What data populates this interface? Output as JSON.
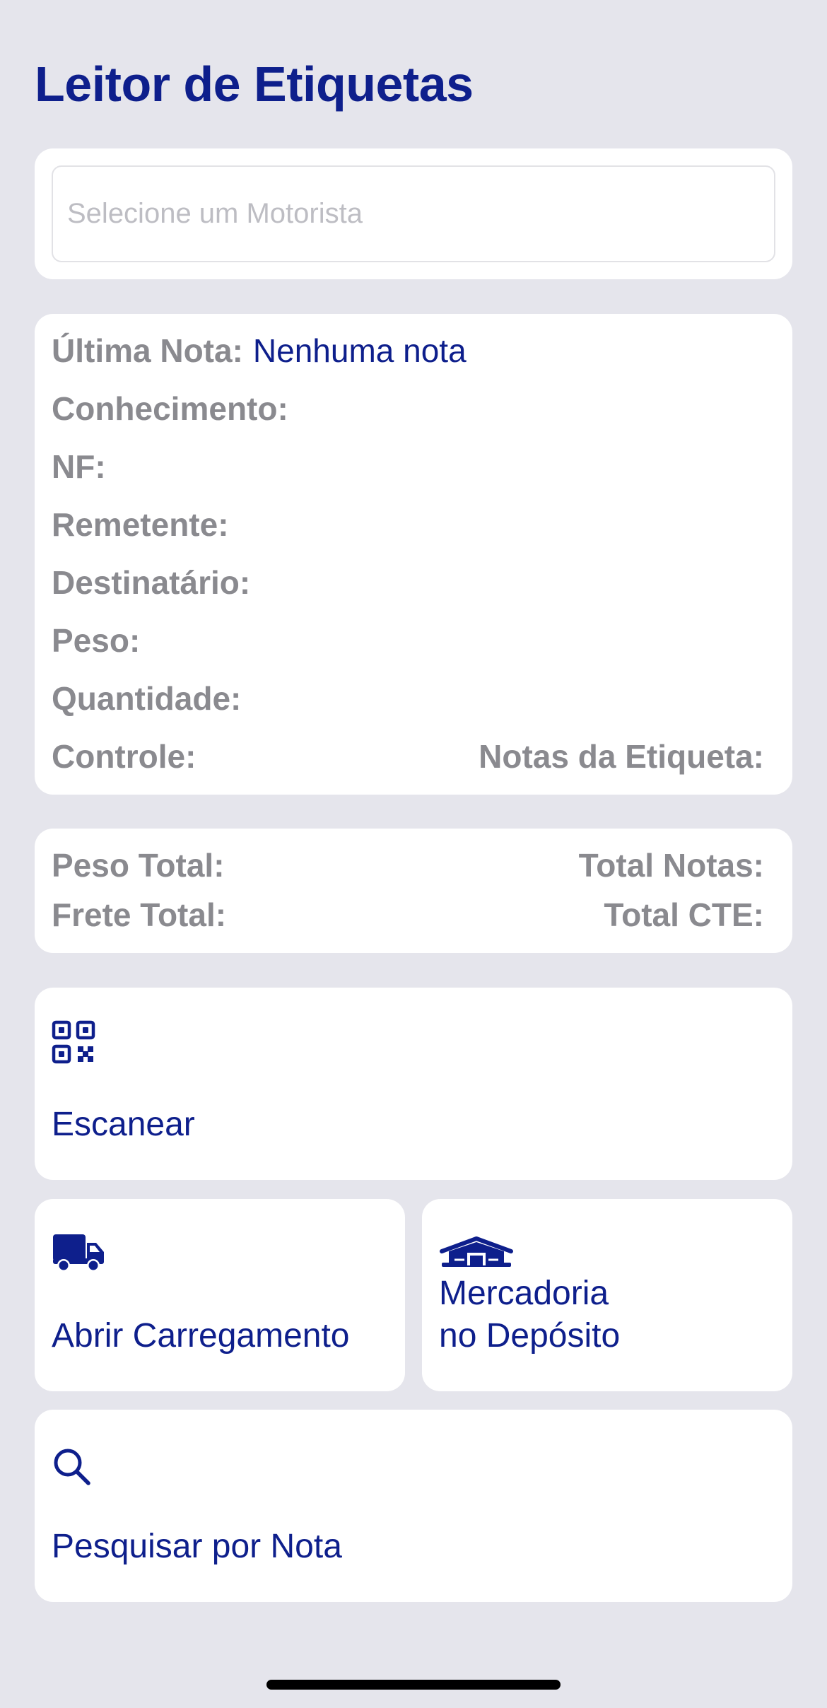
{
  "app": {
    "title": "Leitor de Etiquetas"
  },
  "driver": {
    "placeholder": "Selecione um Motorista",
    "value": ""
  },
  "info": {
    "ultima_nota_label": "Última Nota:",
    "ultima_nota_value": "Nenhuma nota",
    "conhecimento_label": "Conhecimento:",
    "nf_label": "NF:",
    "remetente_label": "Remetente:",
    "destinatario_label": "Destinatário:",
    "peso_label": "Peso:",
    "quantidade_label": "Quantidade:",
    "controle_label": "Controle:",
    "notas_etiqueta_label": "Notas da Etiqueta:"
  },
  "totals": {
    "peso_total_label": "Peso Total:",
    "total_notas_label": "Total Notas:",
    "frete_total_label": "Frete Total:",
    "total_cte_label": "Total CTE:"
  },
  "actions": {
    "scan": {
      "label": "Escanear",
      "icon": "qr-code-icon"
    },
    "load": {
      "label": "Abrir Carregamento",
      "icon": "truck-icon"
    },
    "depot": {
      "label_line1": "Mercadoria",
      "label_line2": "no Depósito",
      "icon": "warehouse-icon"
    },
    "search": {
      "label": "Pesquisar por Nota",
      "icon": "search-icon"
    }
  },
  "colors": {
    "accent": "#0E1F8C",
    "label_gray": "#8A8A8F",
    "background": "#E5E5EC",
    "card": "#FFFFFF"
  }
}
